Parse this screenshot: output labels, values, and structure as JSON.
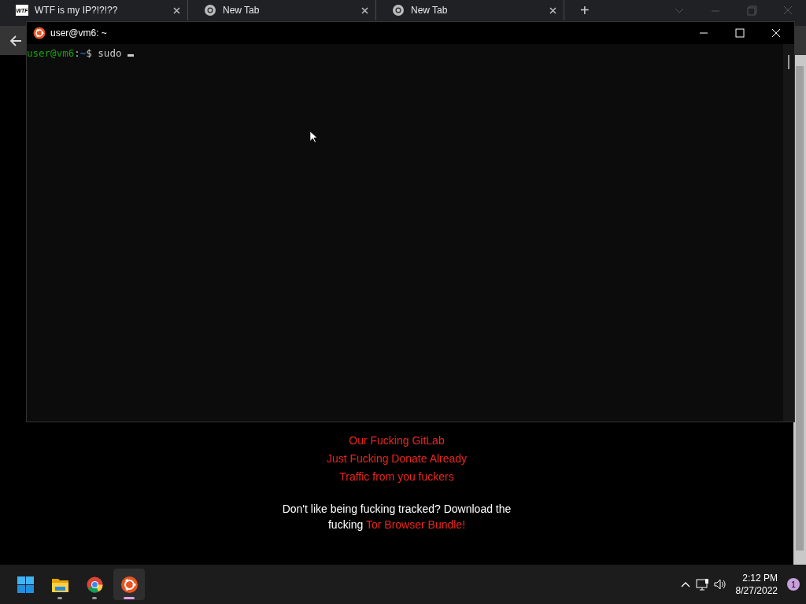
{
  "browser": {
    "tabs": [
      {
        "title": "WTF is my IP?!?!??",
        "favicon": "WTF",
        "kind": "site"
      },
      {
        "title": "New Tab",
        "kind": "chrome"
      },
      {
        "title": "New Tab",
        "kind": "chrome"
      }
    ],
    "new_tab": "+"
  },
  "page": {
    "links": [
      {
        "text": "Our Fucking GitLab",
        "selected": false
      },
      {
        "text": "Just Fucking Donate Already",
        "selected": false
      },
      {
        "text": "Traffic from you fuckers",
        "selected": false
      }
    ],
    "notice": {
      "text": "Don't like being fucking tracked? Download the fucking",
      "link": "Tor Browser Bundle!"
    }
  },
  "terminal": {
    "title": "user@vm6: ~",
    "prompt_user": "user@vm6",
    "prompt_sep": ":",
    "prompt_path": "~",
    "prompt_symbol": "$",
    "command": "sudo"
  },
  "taskbar": {
    "apps": [
      {
        "kind": "start",
        "running": false,
        "selected": false
      },
      {
        "kind": "files",
        "running": true,
        "selected": false
      },
      {
        "kind": "chrome",
        "running": true,
        "selected": false
      },
      {
        "kind": "ubuntu",
        "running": true,
        "selected": true
      }
    ],
    "time": "2:12 PM",
    "date": "8/27/2022",
    "notifications": "1"
  }
}
